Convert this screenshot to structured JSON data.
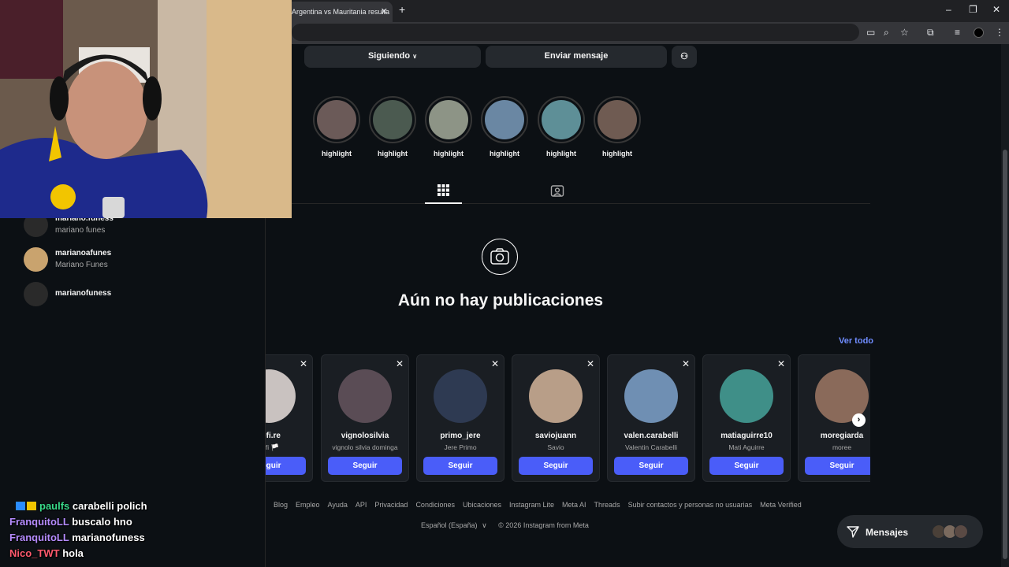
{
  "browser": {
    "tab_title": "Argentina vs Mauritania resulta",
    "tab_close": "✕",
    "new_tab": "+",
    "window_controls": [
      "–",
      "❐",
      "✕"
    ]
  },
  "profile": {
    "following_button": "Siguiendo",
    "message_button": "Enviar mensaje",
    "highlights": [
      {
        "label": "highlight",
        "color": "#6b5a58"
      },
      {
        "label": "highlight",
        "color": "#4b5a50"
      },
      {
        "label": "highlight",
        "color": "#8d9486"
      },
      {
        "label": "highlight",
        "color": "#6a87a3"
      },
      {
        "label": "highlight",
        "color": "#5e8f97"
      },
      {
        "label": "highlight",
        "color": "#6f5b52"
      }
    ],
    "empty_state_title": "Aún no hay publicaciones"
  },
  "suggestions": {
    "see_all": "Ver todo",
    "cards": [
      {
        "username": "sofi.re",
        "name": "sofi 🏳️",
        "button": "Seguir",
        "color": "#c9c2c0"
      },
      {
        "username": "vignolosilvia",
        "name": "vignolo silvia dominga",
        "button": "Seguir",
        "color": "#5a4c55"
      },
      {
        "username": "primo_jere",
        "name": "Jere Primo",
        "button": "Seguir",
        "color": "#2e3a52"
      },
      {
        "username": "saviojuann",
        "name": "Savio",
        "button": "Seguir",
        "color": "#b89e88"
      },
      {
        "username": "valen.carabelli",
        "name": "Valentin Carabelli",
        "button": "Seguir",
        "color": "#6f8fb3"
      },
      {
        "username": "matiaguirre10",
        "name": "Mati Aguirre",
        "button": "Seguir",
        "color": "#3f8f88"
      },
      {
        "username": "moregiarda",
        "name": "moree",
        "button": "Seguir",
        "color": "#8a6a5a"
      }
    ]
  },
  "footer": {
    "links": [
      "Blog",
      "Empleo",
      "Ayuda",
      "API",
      "Privacidad",
      "Condiciones",
      "Ubicaciones",
      "Instagram Lite",
      "Meta AI",
      "Threads",
      "Subir contactos y personas no usuarias",
      "Meta Verified"
    ],
    "language": "Español (España)",
    "copyright": "© 2026 Instagram from Meta"
  },
  "messages_pill": {
    "label": "Mensajes"
  },
  "search_results": [
    {
      "username": "mariano.funess",
      "name": "mariano funes",
      "has_photo": false
    },
    {
      "username": "marianoafunes",
      "name": "Mariano Funes",
      "has_photo": true
    },
    {
      "username": "marianofuness",
      "name": "",
      "has_photo": false
    }
  ],
  "stream_chat": [
    {
      "user": "paulfs",
      "message": "carabelli polich",
      "color": "#39d98a"
    },
    {
      "user": "FranquitoLL",
      "message": "buscalo hno",
      "color": "#b58cff"
    },
    {
      "user": "FranquitoLL",
      "message": "marianofuness",
      "color": "#b58cff"
    },
    {
      "user": "Nico_TWT",
      "message": "hola",
      "color": "#ff5a6e"
    }
  ]
}
